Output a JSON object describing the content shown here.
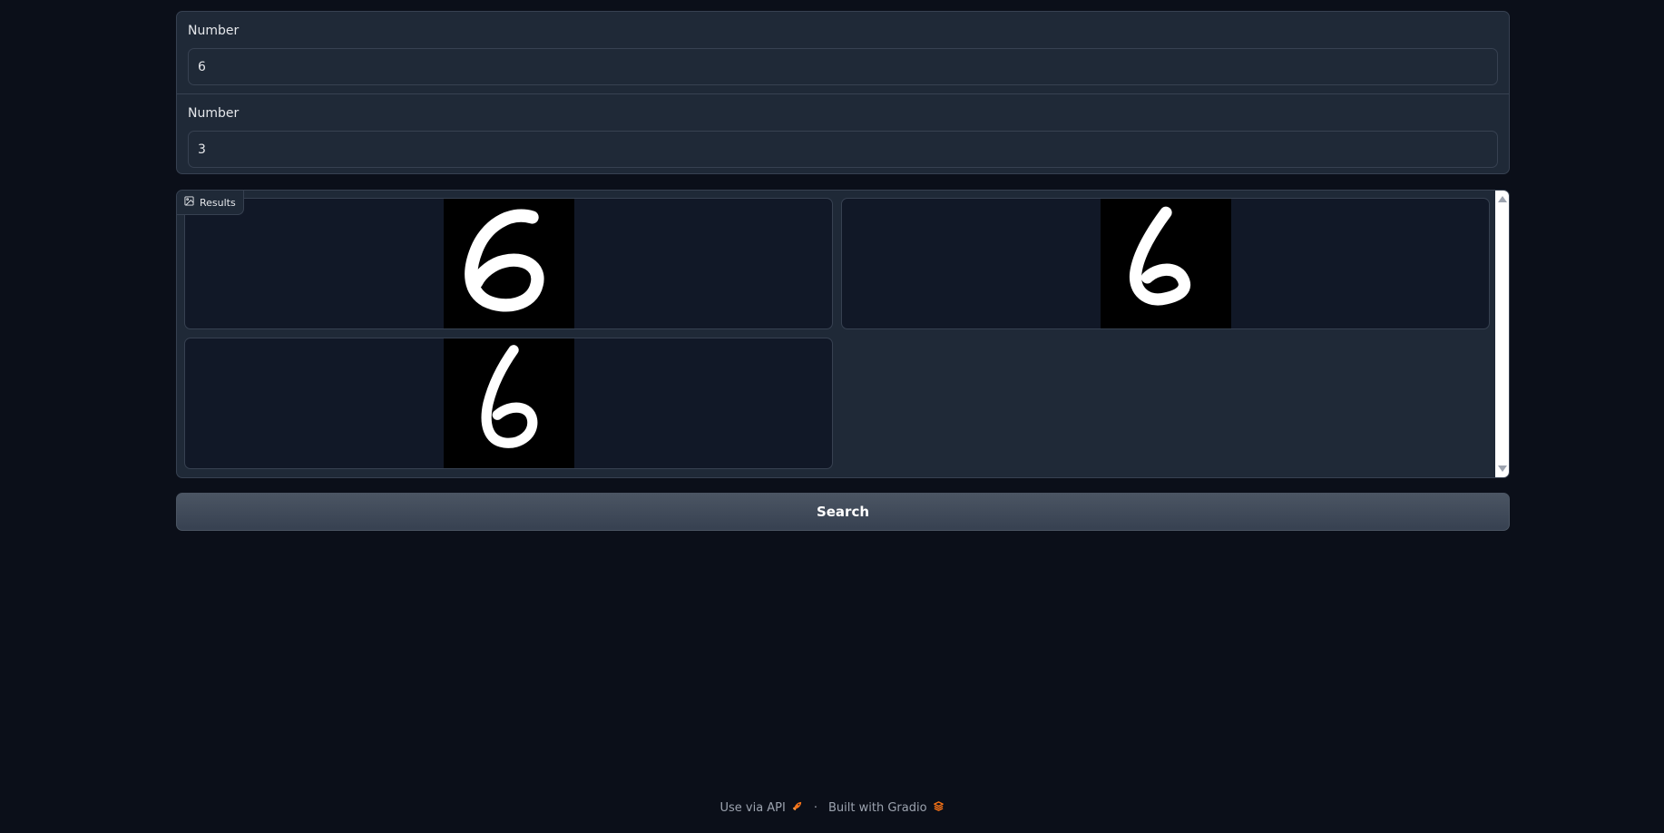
{
  "inputs": {
    "first": {
      "label": "Number",
      "value": "6"
    },
    "second": {
      "label": "Number",
      "value": "3"
    }
  },
  "gallery": {
    "label": "Results",
    "icon": "image-icon",
    "item_count": 3
  },
  "search_button": {
    "label": "Search"
  },
  "footer": {
    "api_label": "Use via API",
    "api_icon": "rocket-icon",
    "separator": "·",
    "built_label": "Built with Gradio",
    "built_icon": "gradio-logo-icon"
  },
  "colors": {
    "page_background": "#0b0f19",
    "panel_background": "#1f2937",
    "panel_border": "#374151",
    "thumb_background": "#111827",
    "button_background": "#4b5563",
    "accent_orange": "#f97316"
  }
}
